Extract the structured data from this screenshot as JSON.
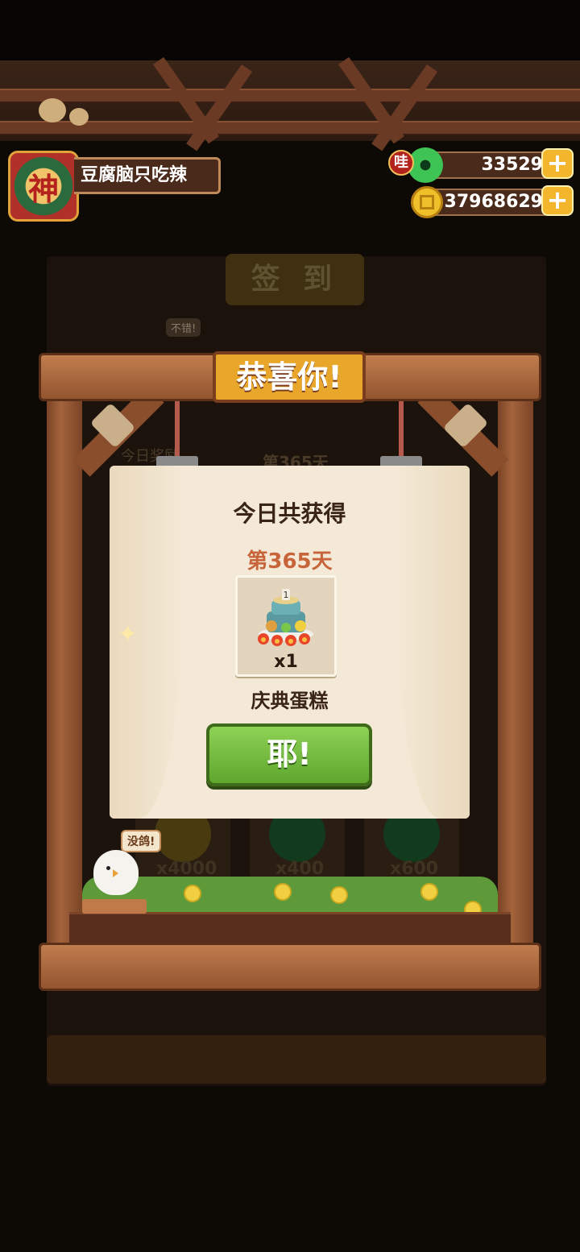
{
  "player": {
    "avatar_char": "神",
    "name": "豆腐脑只吃辣"
  },
  "currencies": {
    "jade": {
      "badge": "哇",
      "amount": "33529",
      "icon": "jade-coin-icon"
    },
    "coins": {
      "amount": "37968629",
      "icon": "copper-coin-icon"
    },
    "plus_symbol": "+"
  },
  "background": {
    "panel_title": "签 到",
    "stage_label_left": "今日奖励",
    "stage_label_center": "第365天",
    "speech_dim": "不错!",
    "rewards": [
      "x4000",
      "x400",
      "x600"
    ]
  },
  "dialog": {
    "title": "恭喜你!",
    "heading": "今日共获得",
    "day": "第365天",
    "item": {
      "name": "庆典蛋糕",
      "quantity": "x1",
      "icon": "celebration-cake-icon"
    },
    "confirm_label": "耶!"
  },
  "mascot": {
    "speech": "没鸽!"
  },
  "colors": {
    "wood": "#a4643c",
    "title_gold": "#e8a62a",
    "button_green": "#7bc246",
    "day_text": "#c8643a",
    "paper": "#f3e9d6"
  }
}
